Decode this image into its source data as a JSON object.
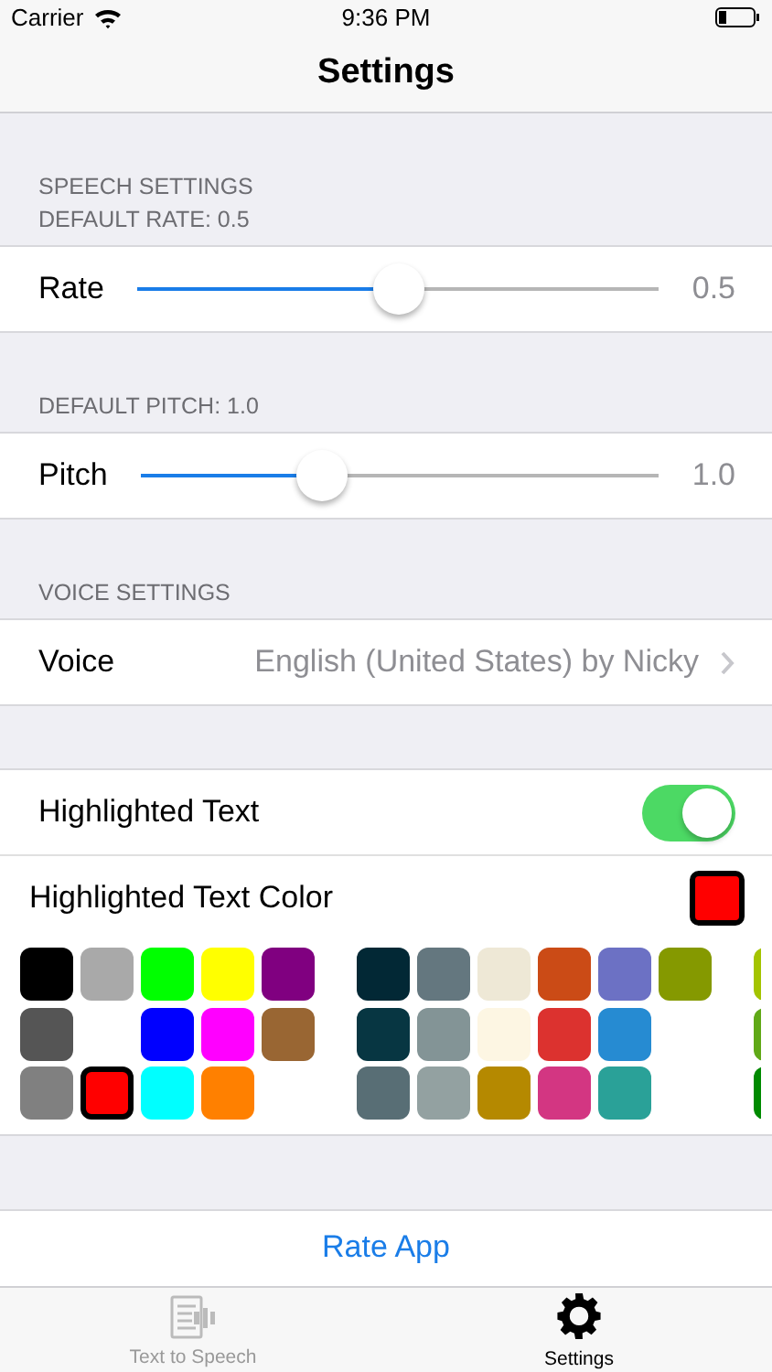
{
  "status_bar": {
    "carrier": "Carrier",
    "time": "9:36 PM"
  },
  "nav": {
    "title": "Settings"
  },
  "sections": [
    {
      "headers": [
        "SPEECH SETTINGS",
        "DEFAULT RATE: 0.5"
      ],
      "rows": [
        {
          "kind": "slider",
          "label": "Rate",
          "level": 0.5,
          "reading": "0.5"
        }
      ]
    },
    {
      "headers": [
        "DEFAULT PITCH: 1.0"
      ],
      "rows": [
        {
          "kind": "slider",
          "label": "Pitch",
          "level": 0.35,
          "reading": "1.0"
        }
      ]
    },
    {
      "headers": [
        "VOICE SETTINGS"
      ],
      "rows": [
        {
          "kind": "disclosure",
          "label": "Voice",
          "value": "English (United States) by Nicky"
        }
      ]
    },
    {
      "rows": [
        {
          "kind": "toggle",
          "label": "Highlighted Text",
          "on": true
        },
        {
          "kind": "color",
          "label": "Highlighted Text Color",
          "color": "#ff0000"
        }
      ]
    }
  ],
  "palette": [
    {
      "rows": [
        [
          {
            "kind": "swatch",
            "color": "#000000",
            "selected": false
          },
          {
            "kind": "swatch",
            "color": "#a9a9a9",
            "selected": false
          },
          {
            "kind": "swatch",
            "color": "#00ff00",
            "selected": false
          },
          {
            "kind": "swatch",
            "color": "#ffff00",
            "selected": false
          },
          {
            "kind": "swatch",
            "color": "#800080",
            "selected": false
          }
        ],
        [
          {
            "kind": "swatch",
            "color": "#555555",
            "selected": false
          },
          {
            "kind": "blank"
          },
          {
            "kind": "swatch",
            "color": "#0000ff",
            "selected": false
          },
          {
            "kind": "swatch",
            "color": "#ff00ff",
            "selected": false
          },
          {
            "kind": "swatch",
            "color": "#996633",
            "selected": false
          }
        ],
        [
          {
            "kind": "swatch",
            "color": "#808080",
            "selected": false
          },
          {
            "kind": "swatch",
            "color": "#ff0000",
            "selected": true
          },
          {
            "kind": "swatch",
            "color": "#00ffff",
            "selected": false
          },
          {
            "kind": "swatch",
            "color": "#ff8000",
            "selected": false
          },
          {
            "kind": "blank"
          }
        ]
      ]
    },
    {
      "rows": [
        [
          {
            "kind": "swatch",
            "color": "#022835",
            "selected": false
          },
          {
            "kind": "swatch",
            "color": "#64777f",
            "selected": false
          },
          {
            "kind": "swatch",
            "color": "#eee8d6",
            "selected": false
          },
          {
            "kind": "swatch",
            "color": "#cb4b16",
            "selected": false
          },
          {
            "kind": "swatch",
            "color": "#6c71c4",
            "selected": false
          },
          {
            "kind": "swatch",
            "color": "#859900",
            "selected": false
          }
        ],
        [
          {
            "kind": "swatch",
            "color": "#073642",
            "selected": false
          },
          {
            "kind": "swatch",
            "color": "#839496",
            "selected": false
          },
          {
            "kind": "swatch",
            "color": "#fdf6e3",
            "selected": false
          },
          {
            "kind": "swatch",
            "color": "#dc322f",
            "selected": false
          },
          {
            "kind": "swatch",
            "color": "#268bd2",
            "selected": false
          },
          {
            "kind": "blank"
          }
        ],
        [
          {
            "kind": "swatch",
            "color": "#586e75",
            "selected": false
          },
          {
            "kind": "swatch",
            "color": "#93a1a1",
            "selected": false
          },
          {
            "kind": "swatch",
            "color": "#b58900",
            "selected": false
          },
          {
            "kind": "swatch",
            "color": "#d33682",
            "selected": false
          },
          {
            "kind": "swatch",
            "color": "#2aa198",
            "selected": false
          },
          {
            "kind": "blank"
          }
        ]
      ]
    },
    {
      "rows": [
        [
          {
            "kind": "swatch",
            "color": "#a4c400",
            "selected": false
          }
        ],
        [
          {
            "kind": "swatch",
            "color": "#60a917",
            "selected": false
          }
        ],
        [
          {
            "kind": "swatch",
            "color": "#008a00",
            "selected": false
          }
        ]
      ]
    }
  ],
  "action": {
    "label": "Rate App"
  },
  "tabs": [
    {
      "label": "Text to Speech",
      "kind": "speech",
      "selected": false
    },
    {
      "label": "Settings",
      "kind": "gear",
      "selected": true
    }
  ]
}
